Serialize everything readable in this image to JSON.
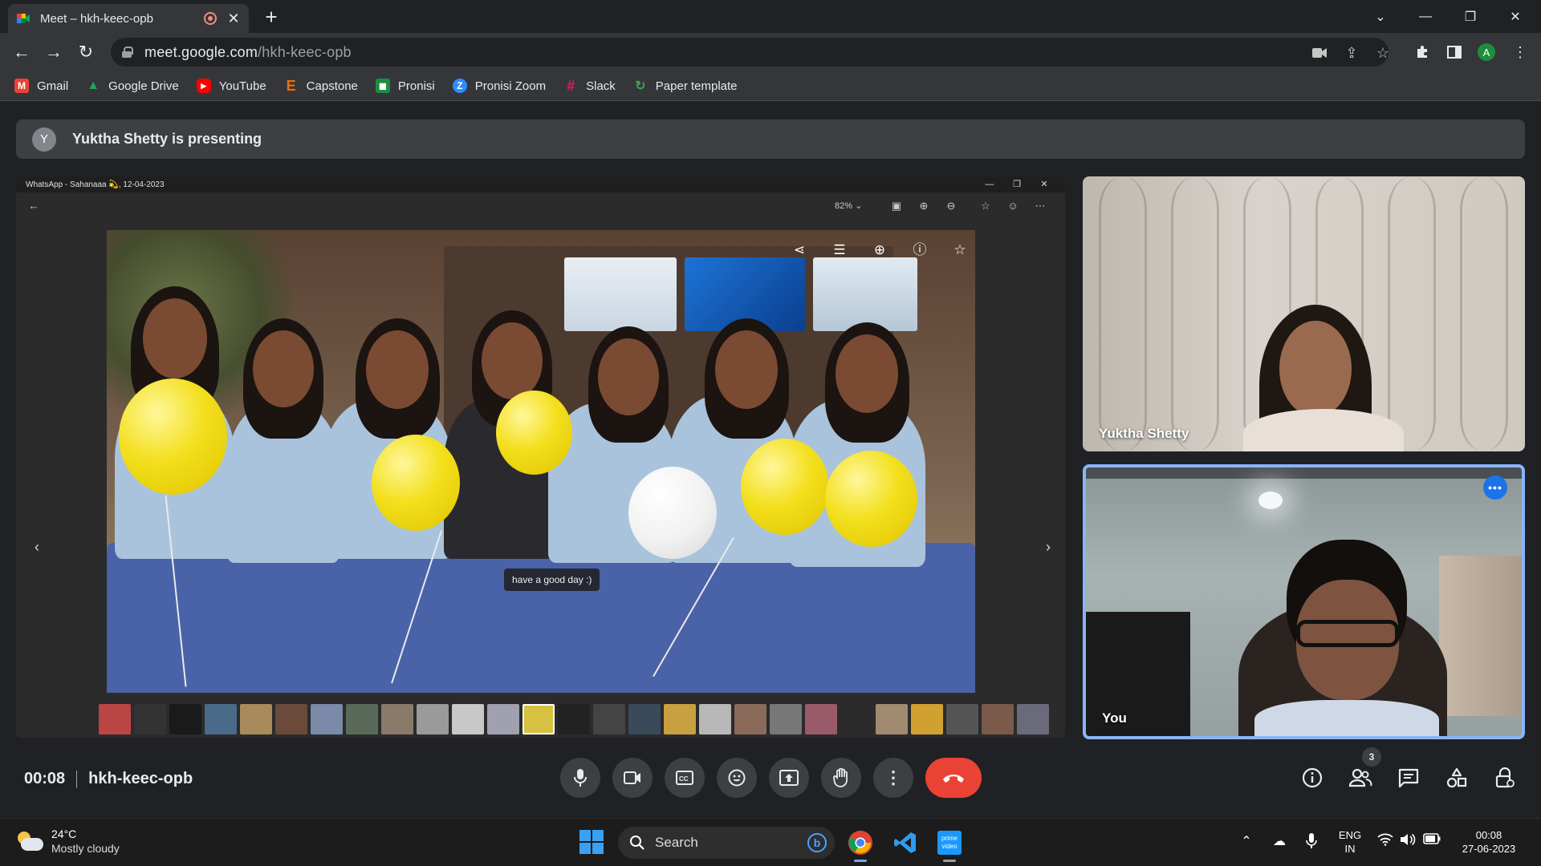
{
  "browser": {
    "tab_title": "Meet – hkh-keec-opb",
    "url_host": "meet.google.com",
    "url_path": "/hkh-keec-opb",
    "bookmarks": [
      {
        "label": "Gmail",
        "icon": "gmail-icon",
        "color": "#ea4335",
        "glyph": "M"
      },
      {
        "label": "Google Drive",
        "icon": "drive-icon",
        "color": "#1fa463",
        "glyph": "▲"
      },
      {
        "label": "YouTube",
        "icon": "youtube-icon",
        "color": "#ff0000",
        "glyph": "▶"
      },
      {
        "label": "Capstone",
        "icon": "capstone-icon",
        "color": "#e8710a",
        "glyph": "E"
      },
      {
        "label": "Pronisi",
        "icon": "classroom-icon",
        "color": "#1e8e3e",
        "glyph": "◼"
      },
      {
        "label": "Pronisi Zoom",
        "icon": "zoom-icon",
        "color": "#2d8cff",
        "glyph": "Z"
      },
      {
        "label": "Slack",
        "icon": "slack-icon",
        "color": "#611f69",
        "glyph": "#"
      },
      {
        "label": "Paper template",
        "icon": "paper-icon",
        "color": "#34a853",
        "glyph": "↻"
      }
    ],
    "profile_initial": "A"
  },
  "meet": {
    "presenter_initial": "Y",
    "presenting_text": "Yuktha Shetty is presenting",
    "shared_window_title": "WhatsApp - Sahanaaa 💫, 12-04-2023",
    "zoom_level": "82%",
    "photo_caption": "have a good day :)",
    "participants": [
      {
        "name": "Yuktha Shetty"
      },
      {
        "name": "You"
      }
    ],
    "elapsed_time": "00:08",
    "meeting_code": "hkh-keec-opb",
    "participant_count": "3"
  },
  "taskbar": {
    "temperature": "24°C",
    "weather": "Mostly cloudy",
    "search_placeholder": "Search",
    "language_line1": "ENG",
    "language_line2": "IN",
    "time": "00:08",
    "date": "27-06-2023"
  },
  "colors": {
    "accent_blue": "#8ab4f8",
    "end_call_red": "#ea4335",
    "meet_bg": "#202124"
  }
}
